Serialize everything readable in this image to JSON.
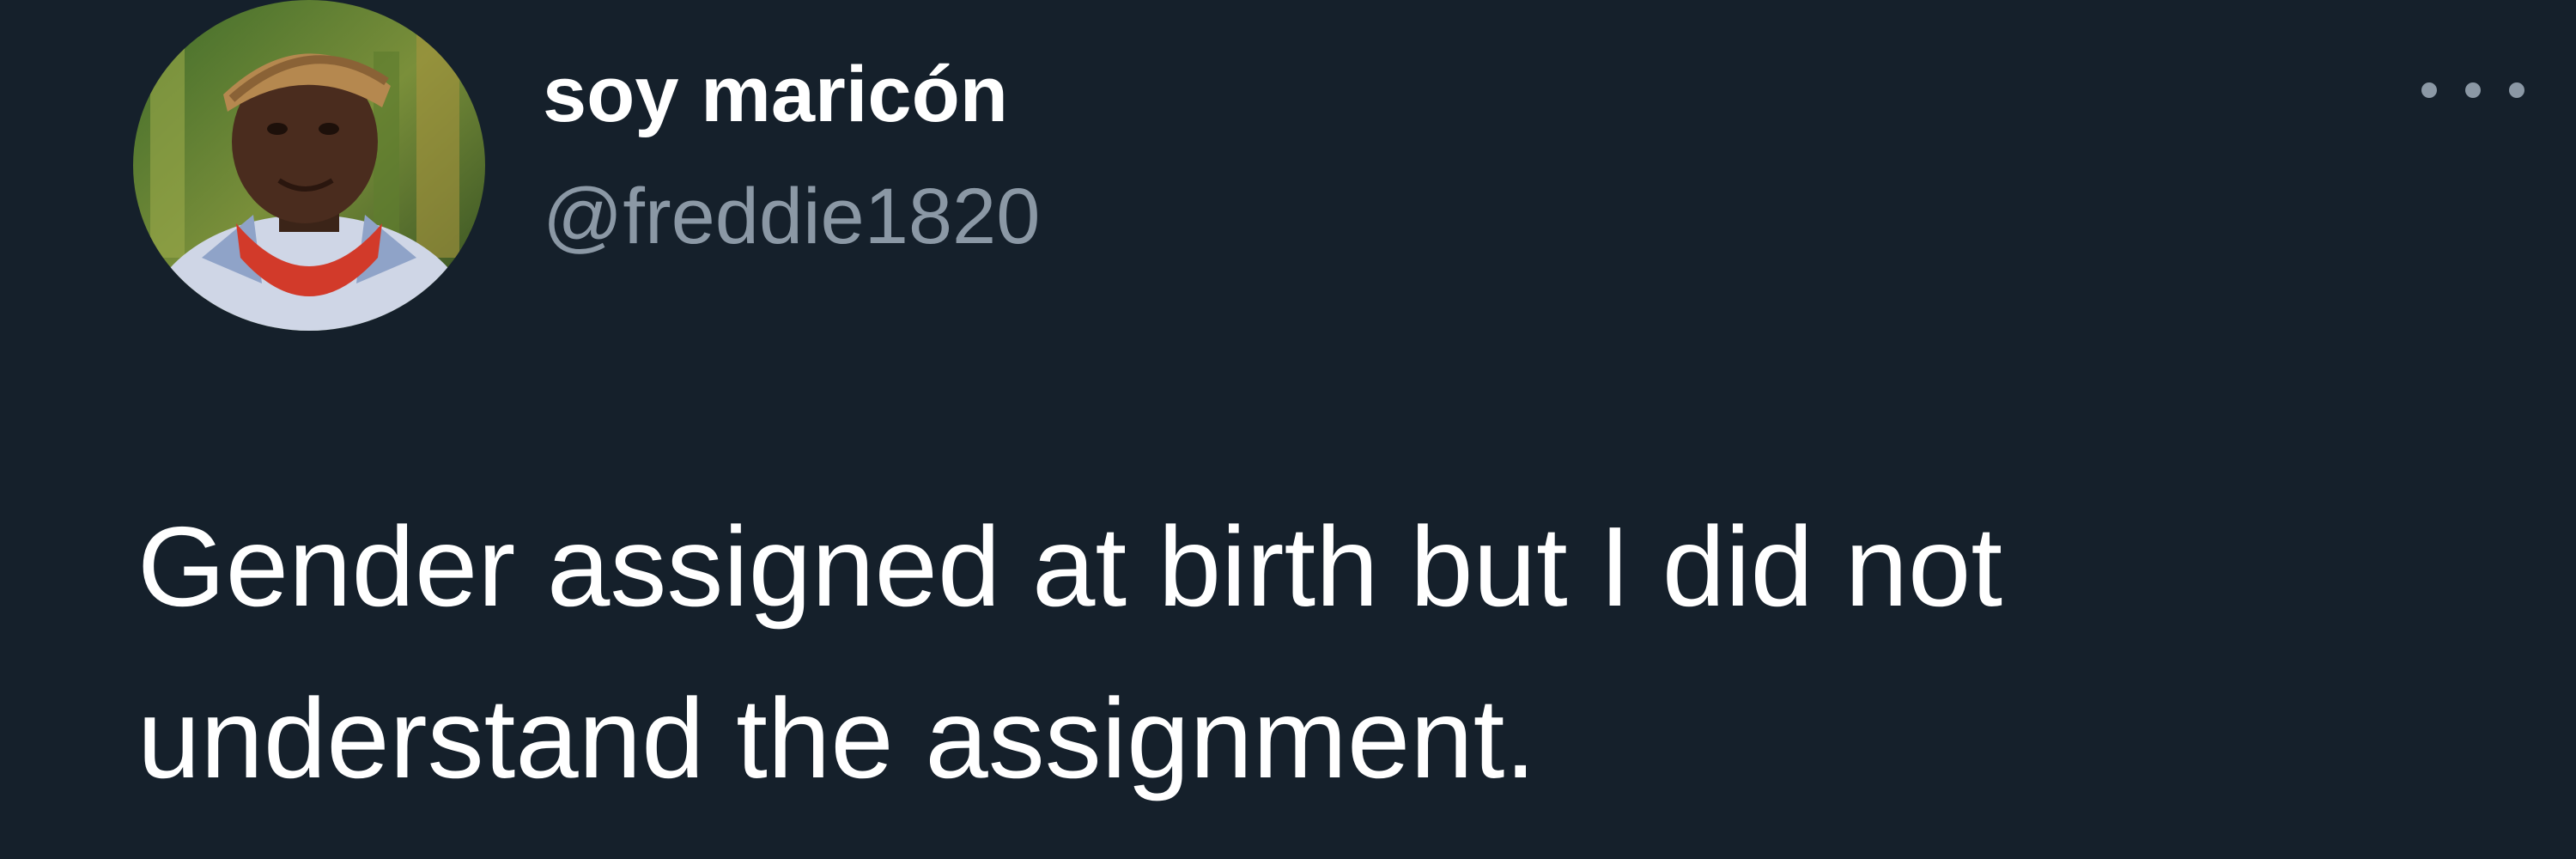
{
  "tweet": {
    "display_name": "soy maricón",
    "handle": "@freddie1820",
    "text": "Gender assigned at birth but I did not understand the assignment.",
    "avatar_icon": "user-avatar",
    "more_icon": "more-horizontal-icon"
  },
  "colors": {
    "background": "#15202b",
    "primary_text": "#ffffff",
    "secondary_text": "#8b98a5"
  }
}
